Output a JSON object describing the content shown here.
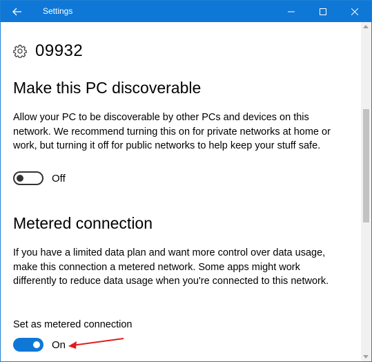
{
  "window": {
    "title": "Settings",
    "accent_color": "#0f78d7"
  },
  "page": {
    "title": "09932",
    "icon": "gear-icon"
  },
  "discoverable": {
    "heading": "Make this PC discoverable",
    "description": "Allow your PC to be discoverable by other PCs and devices on this network. We recommend turning this on for private networks at home or work, but turning it off for public networks to help keep your stuff safe.",
    "toggle_state": "Off"
  },
  "metered": {
    "heading": "Metered connection",
    "description": "If you have a limited data plan and want more control over data usage, make this connection a metered network. Some apps might work differently to reduce data usage when you're connected to this network.",
    "setting_label": "Set as metered connection",
    "toggle_state": "On"
  },
  "annotation": {
    "color": "#e31b1b",
    "icon": "red-arrow-icon"
  }
}
